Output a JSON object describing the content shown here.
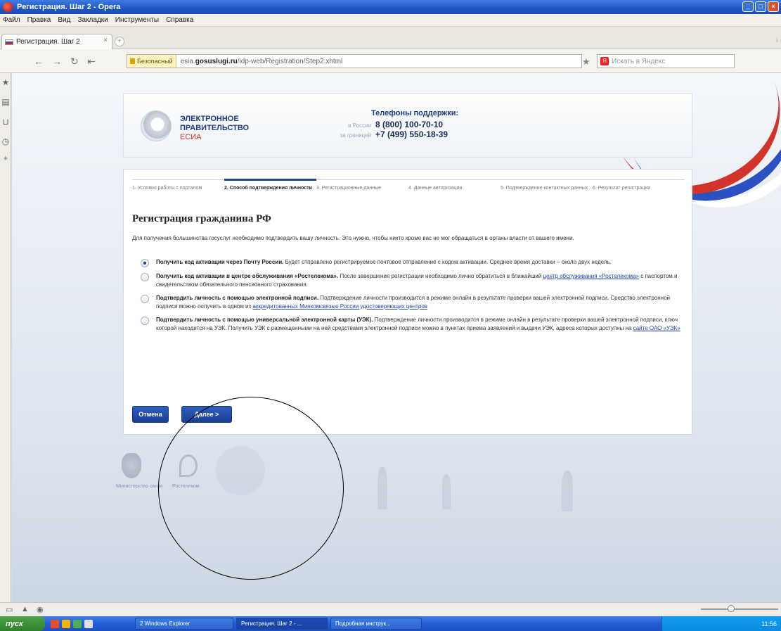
{
  "window": {
    "title": "Регистрация. Шаг 2 - Opera"
  },
  "menu": {
    "items": [
      "Файл",
      "Правка",
      "Вид",
      "Закладки",
      "Инструменты",
      "Справка"
    ]
  },
  "tabs": [
    {
      "label": "Регистрация. Шаг 2"
    }
  ],
  "address": {
    "secure_label": "Безопасный",
    "url_prefix": "esia.",
    "url_host": "gosuslugi.ru",
    "url_path": "/idp-web/Registration/Step2.xhtml",
    "search_placeholder": "Искать в Яндекс"
  },
  "header": {
    "logo_line1": "ЭЛЕКТРОННОЕ",
    "logo_line2": "ПРАВИТЕЛЬСТВО",
    "logo_line3": "ЕСИА",
    "phones_title": "Телефоны поддержки:",
    "phone1_caption": "в России",
    "phone1": "8 (800) 100-70-10",
    "phone2_caption": "за границей",
    "phone2": "+7 (499) 550-18-39"
  },
  "steps": [
    "1. Условия работы с порталом",
    "2. Способ подтверждения личности",
    "3. Регистрационные данные",
    "4. Данные авторизации",
    "5. Подтверждение контактных данных",
    "6. Результат регистрации"
  ],
  "active_step": 2,
  "form": {
    "title": "Регистрация гражданина РФ",
    "intro": "Для получения большинства госуслуг необходимо подтвердить вашу личность. Это нужно, чтобы никто кроме вас не мог обращаться в органы власти от вашего имени.",
    "options": [
      {
        "title": "Получить код активации через Почту России.",
        "text": " Будет отправлено регистрируемое почтовое отправление с кодом активации. Среднее время доставки – около двух недель.",
        "selected": true
      },
      {
        "title": "Получить код активации в центре обслуживания «Ростелекома».",
        "text": " После завершения регистрации необходимо лично обратиться в ближайший ",
        "link": "центр обслуживания «Ростелекома»",
        "text2": " с паспортом и свидетельством обязательного пенсионного страхования.",
        "selected": false
      },
      {
        "title": "Подтвердить личность с помощью электронной подписи.",
        "text": " Подтверждение личности производится в режиме онлайн в результате проверки вашей электронной подписи. Средство электронной подписи можно получить в одном из ",
        "link": "аккредитованных Минкомсвязью России удостоверяющих центров",
        "text2": "",
        "selected": false
      },
      {
        "title": "Подтвердить личность с помощью универсальной электронной карты (УЭК).",
        "text": " Подтверждение личности производится в режиме онлайн в результате проверки вашей электронной подписи, ключ которой находится на УЭК. Получить УЭК с размещенными на ней средствами электронной подписи можно в пунктах приема заявлений и выдачи УЭК, адреса которых доступны на ",
        "link": "сайте ОАО «УЭК»",
        "text2": "",
        "selected": false
      }
    ],
    "cancel_label": "Отмена",
    "next_label": "Далее >"
  },
  "footer": {
    "caption_left": "Министерство связи",
    "caption_right": "Ростелеком"
  },
  "taskbar": {
    "start_label": "пуск",
    "tasks": [
      "2 Windows Explorer",
      "Регистрация. Шаг 2 - ...",
      "Подробная инструк..."
    ],
    "clock": "11:56"
  }
}
